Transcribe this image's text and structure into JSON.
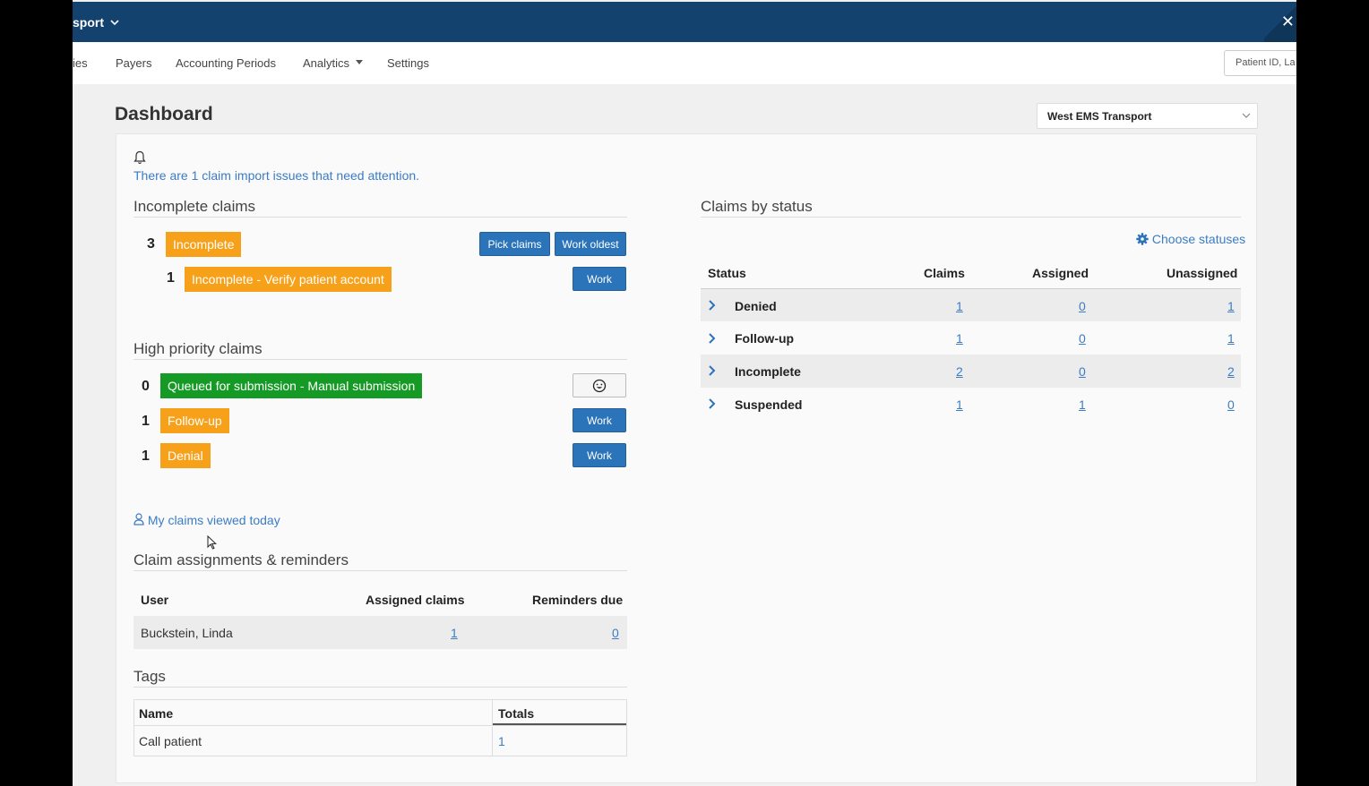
{
  "topbar": {
    "brand": "sport",
    "brand_chevron": "chevron-down-icon",
    "close_icon": "close-icon"
  },
  "nav": {
    "items": [
      "ies",
      "Payers",
      "Accounting Periods",
      "Analytics",
      "Settings"
    ],
    "analytics_caret": "caret-down-icon",
    "search_placeholder": "Patient ID, La"
  },
  "page": {
    "title": "Dashboard",
    "org_select": "West EMS Transport"
  },
  "alert": {
    "icon": "bell-icon",
    "text": "There are 1 claim import issues that need attention."
  },
  "incomplete": {
    "title": "Incomplete claims",
    "rows": [
      {
        "count": "3",
        "label": "Incomplete",
        "buttons": [
          "Pick claims",
          "Work oldest"
        ]
      },
      {
        "count": "1",
        "label": "Incomplete - Verify patient account",
        "buttons": [
          "Work"
        ]
      }
    ]
  },
  "high_priority": {
    "title": "High priority claims",
    "rows": [
      {
        "count": "0",
        "label": "Queued for submission - Manual submission",
        "button_icon": "smiley-icon"
      },
      {
        "count": "1",
        "label": "Follow-up",
        "button": "Work"
      },
      {
        "count": "1",
        "label": "Denial",
        "button": "Work"
      }
    ]
  },
  "my_claims": {
    "icon": "user-icon",
    "text": "My claims viewed today"
  },
  "assignments": {
    "title": "Claim assignments & reminders",
    "headers": [
      "User",
      "Assigned claims",
      "Reminders due"
    ],
    "rows": [
      {
        "user": "Buckstein, Linda",
        "assigned": "1",
        "reminders": "0"
      }
    ]
  },
  "tags": {
    "title": "Tags",
    "headers": [
      "Name",
      "Totals"
    ],
    "rows": [
      {
        "name": "Call patient",
        "total": "1"
      }
    ]
  },
  "status": {
    "title": "Claims by status",
    "choose_icon": "gear-icon",
    "choose_label": "Choose statuses",
    "headers": [
      "Status",
      "Claims",
      "Assigned",
      "Unassigned"
    ],
    "rows": [
      {
        "name": "Denied",
        "claims": "1",
        "assigned": "0",
        "unassigned": "1"
      },
      {
        "name": "Follow-up",
        "claims": "1",
        "assigned": "0",
        "unassigned": "1"
      },
      {
        "name": "Incomplete",
        "claims": "2",
        "assigned": "0",
        "unassigned": "2"
      },
      {
        "name": "Suspended",
        "claims": "1",
        "assigned": "1",
        "unassigned": "0"
      }
    ]
  },
  "colors": {
    "header": "#14426e",
    "primary": "#2c74b9",
    "orange": "#f7a11a",
    "green": "#159b25",
    "link": "#3b7cc4"
  }
}
